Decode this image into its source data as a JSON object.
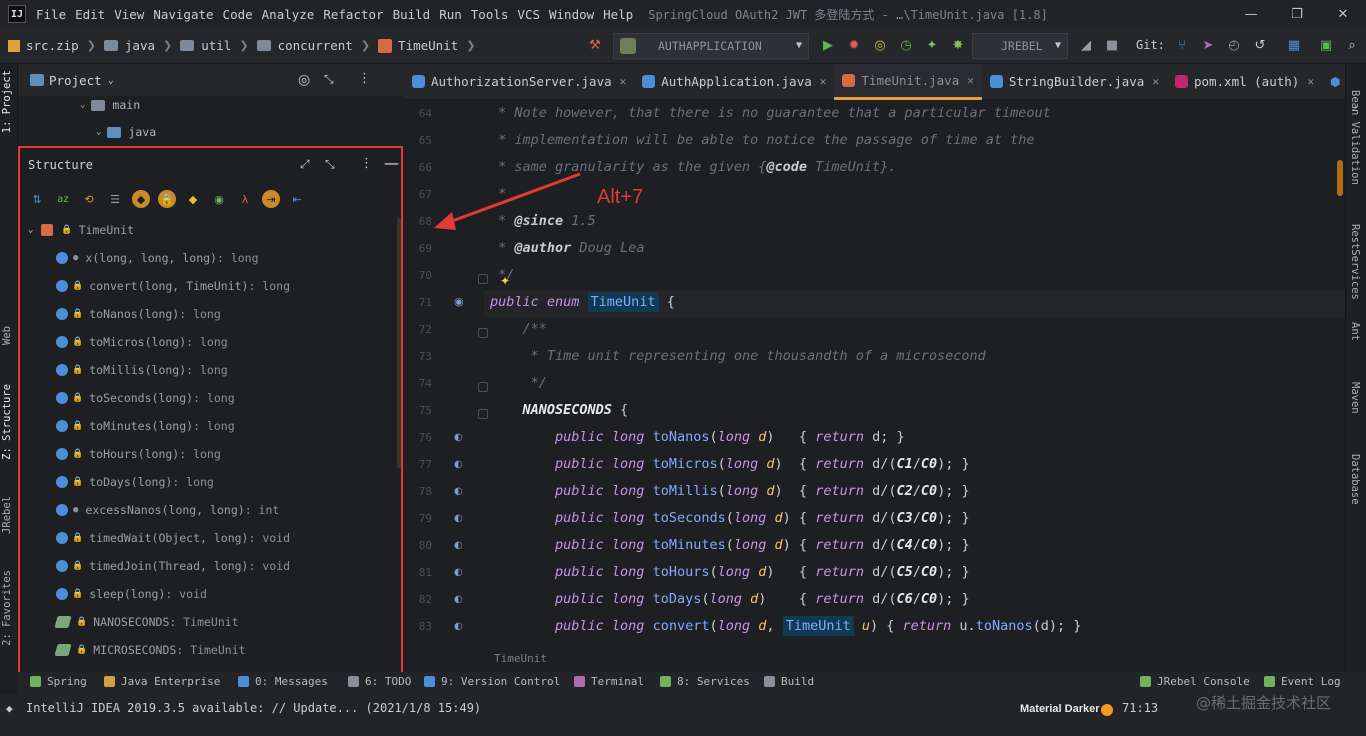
{
  "menubar": {
    "items": [
      {
        "label": "File"
      },
      {
        "label": "Edit"
      },
      {
        "label": "View"
      },
      {
        "label": "Navigate"
      },
      {
        "label": "Code"
      },
      {
        "label": "Analyze"
      },
      {
        "label": "Refactor"
      },
      {
        "label": "Build"
      },
      {
        "label": "Run"
      },
      {
        "label": "Tools"
      },
      {
        "label": "VCS"
      },
      {
        "label": "Window"
      },
      {
        "label": "Help"
      }
    ],
    "window_title": "SpringCloud OAuth2 JWT 多登陆方式 - …\\TimeUnit.java [1.8]",
    "logo": "IJ",
    "controls": {
      "minimize": "—",
      "maximize": "❐",
      "close": "✕"
    }
  },
  "navbar": {
    "crumbs": [
      {
        "label": "src.zip"
      },
      {
        "label": "java"
      },
      {
        "label": "util"
      },
      {
        "label": "concurrent"
      },
      {
        "label": "TimeUnit"
      }
    ],
    "run_config": "AUTHAPPLICATION",
    "jrebel": "JREBEL",
    "git_label": "Git:"
  },
  "left_strip": {
    "tabs": [
      "1: Project",
      "Web",
      "Z: Structure",
      "JRebel",
      "2: Favorites"
    ]
  },
  "project": {
    "title": "Project",
    "tree": [
      {
        "label": "main"
      },
      {
        "label": "java"
      }
    ]
  },
  "structure": {
    "title": "Structure",
    "root": "TimeUnit",
    "items": [
      {
        "name": "x",
        "sig": "(long, long, long)",
        "ret": ": long",
        "vis": "dot"
      },
      {
        "name": "convert",
        "sig": "(long, TimeUnit)",
        "ret": ": long",
        "vis": "lock"
      },
      {
        "name": "toNanos",
        "sig": "(long)",
        "ret": ": long",
        "vis": "lock"
      },
      {
        "name": "toMicros",
        "sig": "(long)",
        "ret": ": long",
        "vis": "lock"
      },
      {
        "name": "toMillis",
        "sig": "(long)",
        "ret": ": long",
        "vis": "lock"
      },
      {
        "name": "toSeconds",
        "sig": "(long)",
        "ret": ": long",
        "vis": "lock"
      },
      {
        "name": "toMinutes",
        "sig": "(long)",
        "ret": ": long",
        "vis": "lock"
      },
      {
        "name": "toHours",
        "sig": "(long)",
        "ret": ": long",
        "vis": "lock"
      },
      {
        "name": "toDays",
        "sig": "(long)",
        "ret": ": long",
        "vis": "lock"
      },
      {
        "name": "excessNanos",
        "sig": "(long, long)",
        "ret": ": int",
        "vis": "dot"
      },
      {
        "name": "timedWait",
        "sig": "(Object, long)",
        "ret": ": void",
        "vis": "lock"
      },
      {
        "name": "timedJoin",
        "sig": "(Thread, long)",
        "ret": ": void",
        "vis": "lock"
      },
      {
        "name": "sleep",
        "sig": "(long)",
        "ret": ": void",
        "vis": "lock"
      },
      {
        "name": "NANOSECONDS",
        "sig": "",
        "ret": ": TimeUnit",
        "vis": "field"
      },
      {
        "name": "MICROSECONDS",
        "sig": "",
        "ret": ": TimeUnit",
        "vis": "field"
      }
    ]
  },
  "editor_tabs": [
    {
      "label": "AuthorizationServer.java",
      "color": "#4c8ed8"
    },
    {
      "label": "AuthApplication.java",
      "color": "#4c8ed8"
    },
    {
      "label": "TimeUnit.java",
      "color": "#d86b43",
      "active": true
    },
    {
      "label": "StringBuilder.java",
      "color": "#4c8ed8"
    },
    {
      "label": "pom.xml (auth)",
      "color": "#c0266e"
    }
  ],
  "editor": {
    "lines": [
      {
        "n": "64",
        "html": "<span class=\"cm\"> * Note however, that there is no guarantee that a particular timeout</span>"
      },
      {
        "n": "65",
        "html": "<span class=\"cm\"> * implementation will be able to notice the passage of time at the</span>"
      },
      {
        "n": "66",
        "html": "<span class=\"cm\"> * same granularity as the given {</span><span class=\"tag\">@code</span><span class=\"cm\"> TimeUnit}.</span>"
      },
      {
        "n": "67",
        "html": "<span class=\"cm\"> *</span>"
      },
      {
        "n": "68",
        "html": "<span class=\"cm\"> * </span><span class=\"tag\">@since</span><span class=\"cm\"> 1.5</span>"
      },
      {
        "n": "69",
        "html": "<span class=\"cm\"> * </span><span class=\"tag\">@author</span><span class=\"cm\"> Doug Lea</span>"
      },
      {
        "n": "70",
        "html": "<span class=\"cm\"> */</span>"
      },
      {
        "n": "71",
        "html": "<span class=\"kw\">public enum</span> <span class=\"hl\">TimeUnit</span> {"
      },
      {
        "n": "72",
        "html": "    <span class=\"cm\">/**</span>"
      },
      {
        "n": "73",
        "html": "<span class=\"cm\">     * Time unit representing one thousandth of a microsecond</span>"
      },
      {
        "n": "74",
        "html": "<span class=\"cm\">     */</span>"
      },
      {
        "n": "75",
        "html": "    <span class=\"cst\">NANOSECONDS</span> {"
      },
      {
        "n": "76",
        "html": "        <span class=\"kw\">public long</span> <span class=\"fn\">toNanos</span>(<span class=\"kw\">long</span> <span class=\"id\">d</span>)   { <span class=\"kw\">return</span> d; }"
      },
      {
        "n": "77",
        "html": "        <span class=\"kw\">public long</span> <span class=\"fn\">toMicros</span>(<span class=\"kw\">long</span> <span class=\"id\">d</span>)  { <span class=\"kw\">return</span> d/(<span class=\"cst\">C1</span>/<span class=\"cst\">C0</span>); }"
      },
      {
        "n": "78",
        "html": "        <span class=\"kw\">public long</span> <span class=\"fn\">toMillis</span>(<span class=\"kw\">long</span> <span class=\"id\">d</span>)  { <span class=\"kw\">return</span> d/(<span class=\"cst\">C2</span>/<span class=\"cst\">C0</span>); }"
      },
      {
        "n": "79",
        "html": "        <span class=\"kw\">public long</span> <span class=\"fn\">toSeconds</span>(<span class=\"kw\">long</span> <span class=\"id\">d</span>) { <span class=\"kw\">return</span> d/(<span class=\"cst\">C3</span>/<span class=\"cst\">C0</span>); }"
      },
      {
        "n": "80",
        "html": "        <span class=\"kw\">public long</span> <span class=\"fn\">toMinutes</span>(<span class=\"kw\">long</span> <span class=\"id\">d</span>) { <span class=\"kw\">return</span> d/(<span class=\"cst\">C4</span>/<span class=\"cst\">C0</span>); }"
      },
      {
        "n": "81",
        "html": "        <span class=\"kw\">public long</span> <span class=\"fn\">toHours</span>(<span class=\"kw\">long</span> <span class=\"id\">d</span>)   { <span class=\"kw\">return</span> d/(<span class=\"cst\">C5</span>/<span class=\"cst\">C0</span>); }"
      },
      {
        "n": "82",
        "html": "        <span class=\"kw\">public long</span> <span class=\"fn\">toDays</span>(<span class=\"kw\">long</span> <span class=\"id\">d</span>)    { <span class=\"kw\">return</span> d/(<span class=\"cst\">C6</span>/<span class=\"cst\">C0</span>); }"
      },
      {
        "n": "83",
        "html": "        <span class=\"kw\">public long</span> <span class=\"fn\">convert</span>(<span class=\"kw\">long</span> <span class=\"id\">d</span>, <span class=\"hl\">TimeUnit</span> <span class=\"id\">u</span>) { <span class=\"kw\">return</span> u.<span class=\"fn\">toNanos</span>(d); }"
      }
    ],
    "breadcrumb": "TimeUnit"
  },
  "annotation": {
    "text": "Alt+7",
    "color": "#e53935"
  },
  "right_strip": {
    "tabs": [
      "Bean Validation",
      "RestServices",
      "Ant",
      "Maven",
      "Database"
    ]
  },
  "bottom_tools": [
    {
      "label": "Spring",
      "color": "#6fb35e"
    },
    {
      "label": "Java Enterprise",
      "color": "#d0a040"
    },
    {
      "label": "0: Messages",
      "color": "#4c8ed8"
    },
    {
      "label": "6: TODO",
      "color": "#8a9099"
    },
    {
      "label": "9: Version Control",
      "color": "#4c8ed8"
    },
    {
      "label": "Terminal",
      "color": "#b06ab3"
    },
    {
      "label": "8: Services",
      "color": "#6fb35e"
    },
    {
      "label": "Build",
      "color": "#8a9099"
    },
    {
      "label": "JRebel Console",
      "color": "#6fb35e"
    },
    {
      "label": "Event Log",
      "color": "#6fb35e"
    }
  ],
  "status": {
    "message": "IntelliJ IDEA 2019.3.5 available: // Update... (2021/1/8 15:49)",
    "theme": "Material Darker",
    "caret": "71:13",
    "watermark": "@稀土掘金技术社区"
  }
}
